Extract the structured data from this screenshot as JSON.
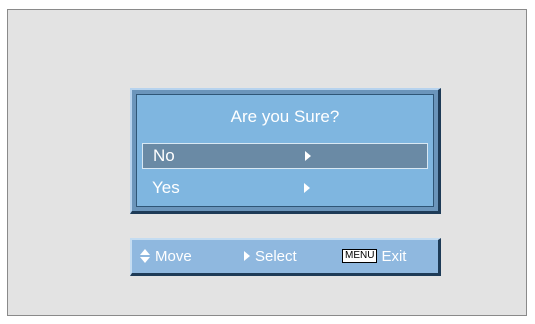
{
  "dialog": {
    "title": "Are you Sure?",
    "options": [
      {
        "label": "No",
        "selected": true
      },
      {
        "label": "Yes",
        "selected": false
      }
    ]
  },
  "helpbar": {
    "move_label": "Move",
    "select_label": "Select",
    "menu_key_label": "MENU",
    "exit_label": "Exit"
  },
  "colors": {
    "screen_background": "#e3e3e3",
    "dialog_background": "#7fb6e0",
    "selected_option_background": "#6a8aa5",
    "helpbar_background": "#8fb8df",
    "text": "#ffffff"
  }
}
